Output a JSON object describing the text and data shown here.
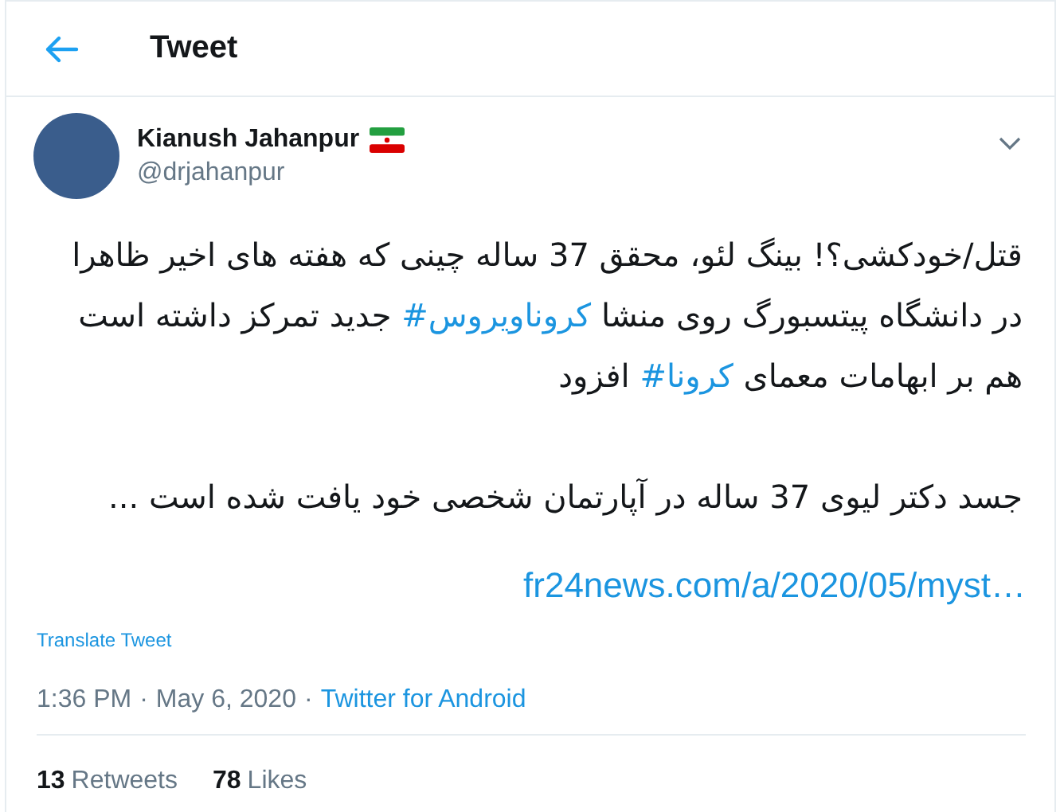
{
  "header": {
    "title": "Tweet"
  },
  "author": {
    "name": "Kianush Jahanpur",
    "handle": "@drjahanpur"
  },
  "body": [
    {
      "segments": [
        {
          "kind": "text",
          "text": "قتل/خودکشی؟!  بینگ لئو، محقق 37 ساله چینی که هفته های اخیر ظاهرا در دانشگاه پیتسبورگ روی منشا "
        },
        {
          "kind": "hashtag",
          "text": "#کروناویروس"
        },
        {
          "kind": "text",
          "text": " جدید تمرکز داشته است هم بر ابهامات معمای "
        },
        {
          "kind": "hashtag",
          "text": "#کرونا"
        },
        {
          "kind": "text",
          "text": " افزود"
        }
      ]
    },
    {
      "segments": [
        {
          "kind": "text",
          "text": "جسد دکتر لیوی 37 ساله در آپارتمان شخصی خود یافت شده است ..."
        }
      ]
    }
  ],
  "link": "fr24news.com/a/2020/05/myst…",
  "translate": "Translate Tweet",
  "meta": {
    "time": "1:36 PM",
    "date": "May 6, 2020",
    "source": "Twitter for Android",
    "separator": "·"
  },
  "retweets": {
    "count": "13",
    "label": "Retweets"
  },
  "likes": {
    "count": "78",
    "label": "Likes"
  }
}
